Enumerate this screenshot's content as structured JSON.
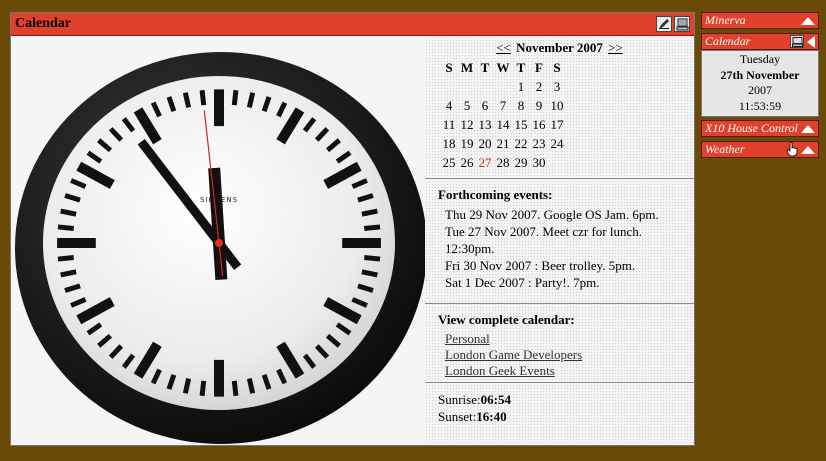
{
  "main_window": {
    "title": "Calendar"
  },
  "calendar": {
    "prev": "<<",
    "month_year": "November 2007",
    "next": ">>",
    "weekdays": [
      "S",
      "M",
      "T",
      "W",
      "T",
      "F",
      "S"
    ],
    "weeks": [
      [
        "",
        "",
        "",
        "",
        "1",
        "2",
        "3"
      ],
      [
        "4",
        "5",
        "6",
        "7",
        "8",
        "9",
        "10"
      ],
      [
        "11",
        "12",
        "13",
        "14",
        "15",
        "16",
        "17"
      ],
      [
        "18",
        "19",
        "20",
        "21",
        "22",
        "23",
        "24"
      ],
      [
        "25",
        "26",
        "27",
        "28",
        "29",
        "30",
        ""
      ]
    ],
    "today": "27",
    "today_color": "#cc2a1a"
  },
  "events": {
    "title": "Forthcoming events:",
    "items": [
      "Thu 29 Nov 2007. Google OS Jam. 6pm.",
      "Tue 27 Nov 2007. Meet czr for lunch. 12:30pm.",
      "Fri 30 Nov 2007 : Beer trolley. 5pm.",
      "Sat 1 Dec 2007 : Party!. 7pm."
    ]
  },
  "complete_calendar": {
    "title": "View complete calendar:",
    "links": [
      "Personal",
      "London Game Developers",
      "London Geek Events"
    ]
  },
  "sun": {
    "sunrise_label": "Sunrise:",
    "sunrise": "06:54",
    "sunset_label": "Sunset:",
    "sunset": "16:40"
  },
  "clock": {
    "brand": "SIEMENS",
    "hour": 11,
    "minute": 53,
    "second": 59
  },
  "sidebar": {
    "minerva": "Minerva",
    "calendar": "Calendar",
    "day": "Tuesday",
    "date": "27th November",
    "year": "2007",
    "time": "11:53:59",
    "x10": "X10 House Control",
    "weather": "Weather"
  },
  "colors": {
    "background": "#6b4a08",
    "title_bar": "#e0402c"
  }
}
